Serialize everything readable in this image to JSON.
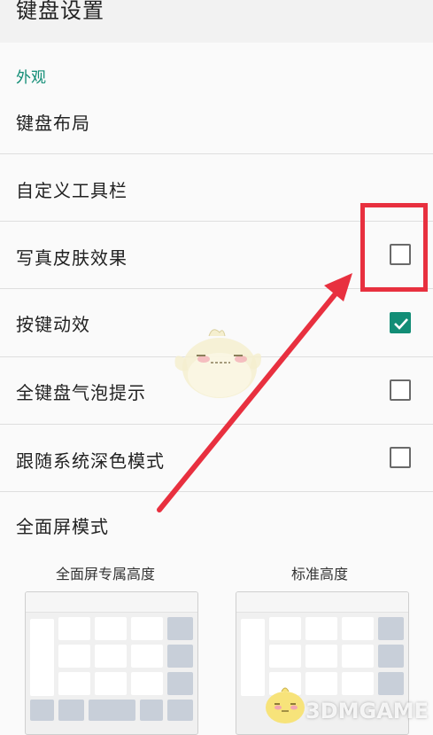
{
  "header": {
    "title": "键盘设置"
  },
  "appearance_section": {
    "label": "外观",
    "items": [
      {
        "label": "键盘布局"
      },
      {
        "label": "自定义工具栏"
      },
      {
        "label": "写真皮肤效果",
        "checked": false
      },
      {
        "label": "按键动效",
        "checked": true
      },
      {
        "label": "全键盘气泡提示",
        "checked": false
      },
      {
        "label": "跟随系统深色模式",
        "checked": false
      }
    ]
  },
  "fullscreen_mode": {
    "title": "全面屏模式",
    "options": [
      {
        "label": "全面屏专属高度"
      },
      {
        "label": "标准高度"
      }
    ]
  },
  "watermark": "3DMGAME",
  "colors": {
    "accent": "#128d76",
    "annotation": "#e8303f"
  }
}
